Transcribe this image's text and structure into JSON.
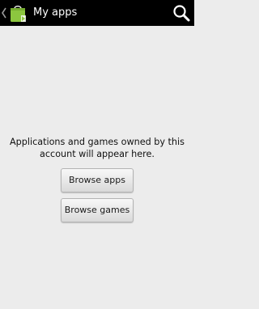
{
  "action_bar": {
    "title": "My apps",
    "up_icon": "chevron-left-icon",
    "app_icon": "play-store-bag-icon",
    "search_icon": "search-icon",
    "background_color": "#000000",
    "title_color": "#ffffff"
  },
  "empty_state": {
    "message": "Applications and games owned by this account will appear here.",
    "browse_apps_label": "Browse apps",
    "browse_games_label": "Browse games"
  },
  "colors": {
    "page_background": "#ececec",
    "icon_green": "#8cc63f"
  }
}
